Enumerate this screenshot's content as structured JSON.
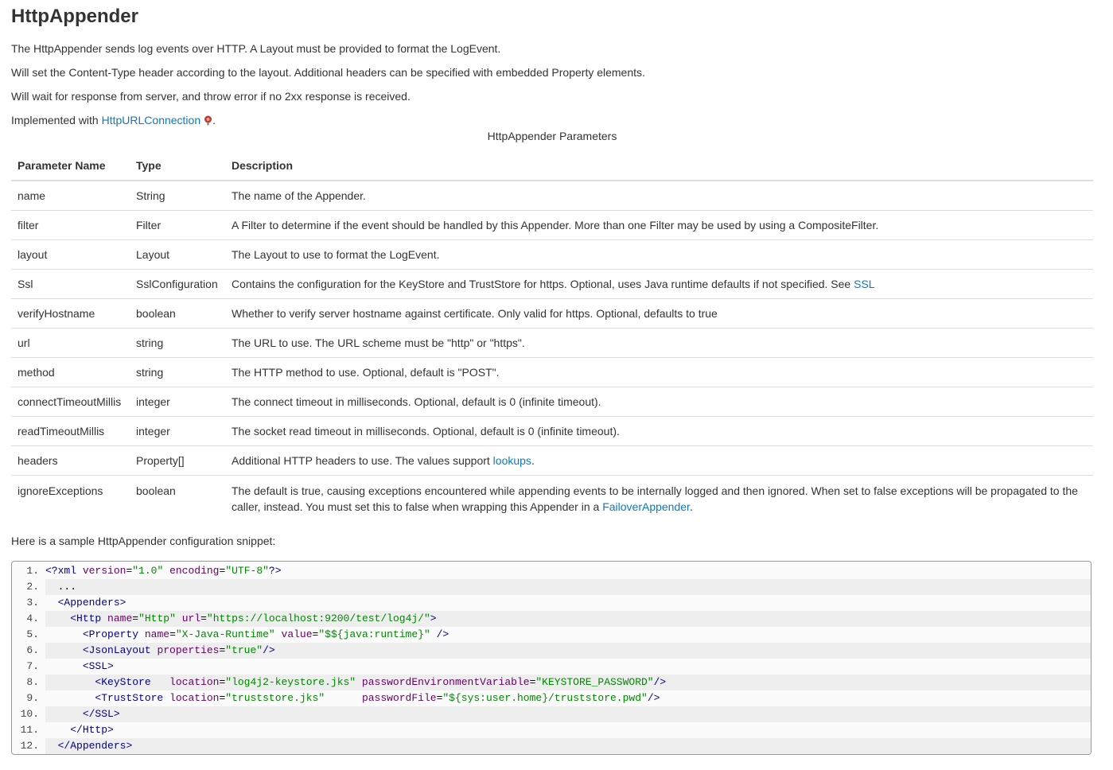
{
  "heading": "HttpAppender",
  "intro": {
    "p1": "The HttpAppender sends log events over HTTP. A Layout must be provided to format the LogEvent.",
    "p2": "Will set the Content-Type header according to the layout. Additional headers can be specified with embedded Property elements.",
    "p3": "Will wait for response from server, and throw error if no 2xx response is received.",
    "p4_prefix": "Implemented with ",
    "p4_link": "HttpURLConnection",
    "p4_suffix": "."
  },
  "table": {
    "caption": "HttpAppender Parameters",
    "headers": [
      "Parameter Name",
      "Type",
      "Description"
    ],
    "rows": [
      {
        "name": "name",
        "type": "String",
        "desc": "The name of the Appender."
      },
      {
        "name": "filter",
        "type": "Filter",
        "desc": "A Filter to determine if the event should be handled by this Appender. More than one Filter may be used by using a CompositeFilter."
      },
      {
        "name": "layout",
        "type": "Layout",
        "desc": "The Layout to use to format the LogEvent."
      },
      {
        "name": "Ssl",
        "type": "SslConfiguration",
        "desc": "Contains the configuration for the KeyStore and TrustStore for https. Optional, uses Java runtime defaults if not specified. See ",
        "link": "SSL"
      },
      {
        "name": "verifyHostname",
        "type": "boolean",
        "desc": "Whether to verify server hostname against certificate. Only valid for https. Optional, defaults to true"
      },
      {
        "name": "url",
        "type": "string",
        "desc": "The URL to use. The URL scheme must be \"http\" or \"https\"."
      },
      {
        "name": "method",
        "type": "string",
        "desc": "The HTTP method to use. Optional, default is \"POST\"."
      },
      {
        "name": "connectTimeoutMillis",
        "type": "integer",
        "desc": "The connect timeout in milliseconds. Optional, default is 0 (infinite timeout)."
      },
      {
        "name": "readTimeoutMillis",
        "type": "integer",
        "desc": "The socket read timeout in milliseconds. Optional, default is 0 (infinite timeout)."
      },
      {
        "name": "headers",
        "type": "Property[]",
        "desc": "Additional HTTP headers to use. The values support ",
        "link": "lookups",
        "suffix": "."
      },
      {
        "name": "ignoreExceptions",
        "type": "boolean",
        "desc": "The default is true, causing exceptions encountered while appending events to be internally logged and then ignored. When set to false exceptions will be propagated to the caller, instead. You must set this to false when wrapping this Appender in a ",
        "link": "FailoverAppender",
        "suffix": "."
      }
    ]
  },
  "snippet_intro": "Here is a sample HttpAppender configuration snippet:",
  "code": {
    "line_numbers": [
      "1.",
      "2.",
      "3.",
      "4.",
      "5.",
      "6.",
      "7.",
      "8.",
      "9.",
      "10.",
      "11.",
      "12."
    ],
    "lines": [
      "<?xml version=\"1.0\" encoding=\"UTF-8\"?>",
      "  ...",
      "  <Appenders>",
      "    <Http name=\"Http\" url=\"https://localhost:9200/test/log4j/\">",
      "      <Property name=\"X-Java-Runtime\" value=\"$${java:runtime}\" />",
      "      <JsonLayout properties=\"true\"/>",
      "      <SSL>",
      "        <KeyStore   location=\"log4j2-keystore.jks\" passwordEnvironmentVariable=\"KEYSTORE_PASSWORD\"/>",
      "        <TrustStore location=\"truststore.jks\"      passwordFile=\"${sys:user.home}/truststore.pwd\"/>",
      "      </SSL>",
      "    </Http>",
      "  </Appenders>"
    ]
  },
  "colors": {
    "link": "#0a7ac2",
    "text": "#333333",
    "xml_tag": "#000088",
    "xml_attr_name": "#660066",
    "xml_attr_value": "#008800"
  },
  "icons": {
    "external_link": "external-link-icon"
  }
}
